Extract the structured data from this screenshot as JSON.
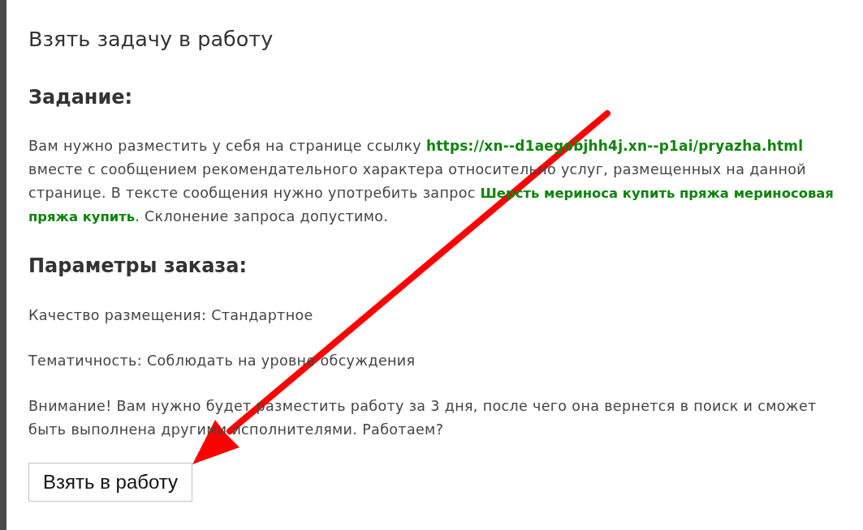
{
  "dialog": {
    "title": "Взять задачу в работу"
  },
  "task": {
    "heading": "Задание:",
    "paragraph": [
      {
        "kind": "text",
        "text": "Вам нужно разместить у себя на странице ссылку "
      },
      {
        "kind": "link",
        "text": "https://xn--d1aegobjhh4j.xn--p1ai/pryazha.html"
      },
      {
        "kind": "text",
        "text": " вместе с сообщением рекомендательного характера относительно услуг, размещенных на данной странице. В тексте сообщения нужно употребить запрос **Шерсть мериноса купить пряжа мериносовая пряжа купить**. Склонение запроса допустимо."
      }
    ]
  },
  "parameters": {
    "heading": "Параметры заказа:",
    "items": [
      "Качество размещения: Стандартное",
      "Тематичность: Соблюдать на уровне обсуждения"
    ]
  },
  "notice": "Внимание! Вам нужно будет разместить работу за 3 дня, после чего она вернется в поиск и сможет быть выполнена другими исполнителями. Работаем?",
  "buttons": [
    {
      "label": "Взять в работу"
    }
  ],
  "annotation": {
    "kind": "arrow"
  }
}
